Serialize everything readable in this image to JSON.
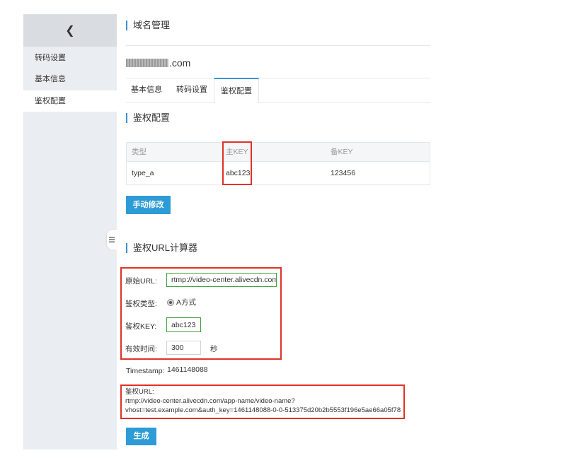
{
  "sidebar": {
    "back_glyph": "❮",
    "items": [
      {
        "label": "转码设置"
      },
      {
        "label": "基本信息"
      },
      {
        "label": "鉴权配置"
      }
    ],
    "active_index": 2
  },
  "header": {
    "title": "域名管理"
  },
  "domain": {
    "suffix": ".com"
  },
  "tabs": [
    {
      "label": "基本信息"
    },
    {
      "label": "转码设置"
    },
    {
      "label": "鉴权配置"
    }
  ],
  "active_tab_index": 2,
  "auth_config": {
    "title": "鉴权配置",
    "columns": [
      "类型",
      "主KEY",
      "备KEY"
    ],
    "rows": [
      [
        "type_a",
        "abc123",
        "123456"
      ]
    ],
    "manual_edit_label": "手动修改"
  },
  "calculator": {
    "title": "鉴权URL计算器",
    "source_url_label": "原始URL:",
    "source_url_value": "rtmp://video-center.alivecdn.com/a",
    "auth_type_label": "鉴权类型:",
    "auth_type_option": "A方式",
    "auth_key_label": "鉴权KEY:",
    "auth_key_value": "abc123",
    "valid_time_label": "有效时间:",
    "valid_time_value": "300",
    "valid_time_unit": "秒",
    "timestamp_label": "Timestamp:",
    "timestamp_value": "1461148088",
    "result_label": "鉴权URL:",
    "result_line1": "rtmp://video-center.alivecdn.com/app-name/video-name?",
    "result_line2": "vhost=test.example.com&auth_key=1461148088-0-0-513375d20b2b5553f196e5ae66a05f78",
    "generate_label": "生成"
  },
  "colors": {
    "accent": "#2d9bd6",
    "highlight_red": "#e03226",
    "input_green": "#3fa33c",
    "sidebar_bg": "#eaedf1"
  }
}
